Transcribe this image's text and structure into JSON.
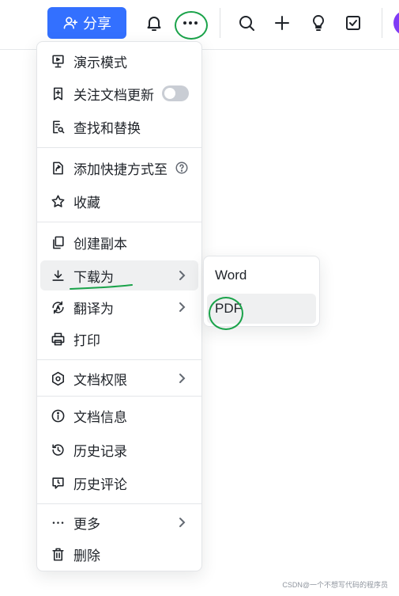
{
  "toolbar": {
    "share_label": "分享",
    "icons": [
      "bell-icon",
      "more-icon",
      "search-icon",
      "plus-icon",
      "lightbulb-icon",
      "checkbox-icon"
    ],
    "accent_color": "#3370ff"
  },
  "menu": {
    "items": [
      {
        "label": "演示模式",
        "icon": "presentation-icon"
      },
      {
        "label": "关注文档更新",
        "icon": "bookmark-plus-icon",
        "toggle": false
      },
      {
        "label": "查找和替换",
        "icon": "find-replace-icon"
      },
      {
        "label": "添加快捷方式至",
        "icon": "shortcut-icon"
      },
      {
        "label": "收藏",
        "icon": "star-icon"
      },
      {
        "label": "创建副本",
        "icon": "copy-icon"
      },
      {
        "label": "下载为",
        "icon": "download-icon",
        "active": true
      },
      {
        "label": "翻译为",
        "icon": "translate-icon"
      },
      {
        "label": "打印",
        "icon": "printer-icon"
      },
      {
        "label": "文档权限",
        "icon": "gear-icon"
      },
      {
        "label": "文档信息",
        "icon": "info-icon"
      },
      {
        "label": "历史记录",
        "icon": "history-icon"
      },
      {
        "label": "历史评论",
        "icon": "comment-history-icon"
      },
      {
        "label": "更多",
        "icon": "ellipsis-icon"
      },
      {
        "label": "删除",
        "icon": "trash-icon"
      }
    ]
  },
  "submenu": {
    "items": [
      {
        "label": "Word"
      },
      {
        "label": "PDF",
        "active": true
      }
    ]
  },
  "watermark": "CSDN@一个不想写代码的程序员"
}
